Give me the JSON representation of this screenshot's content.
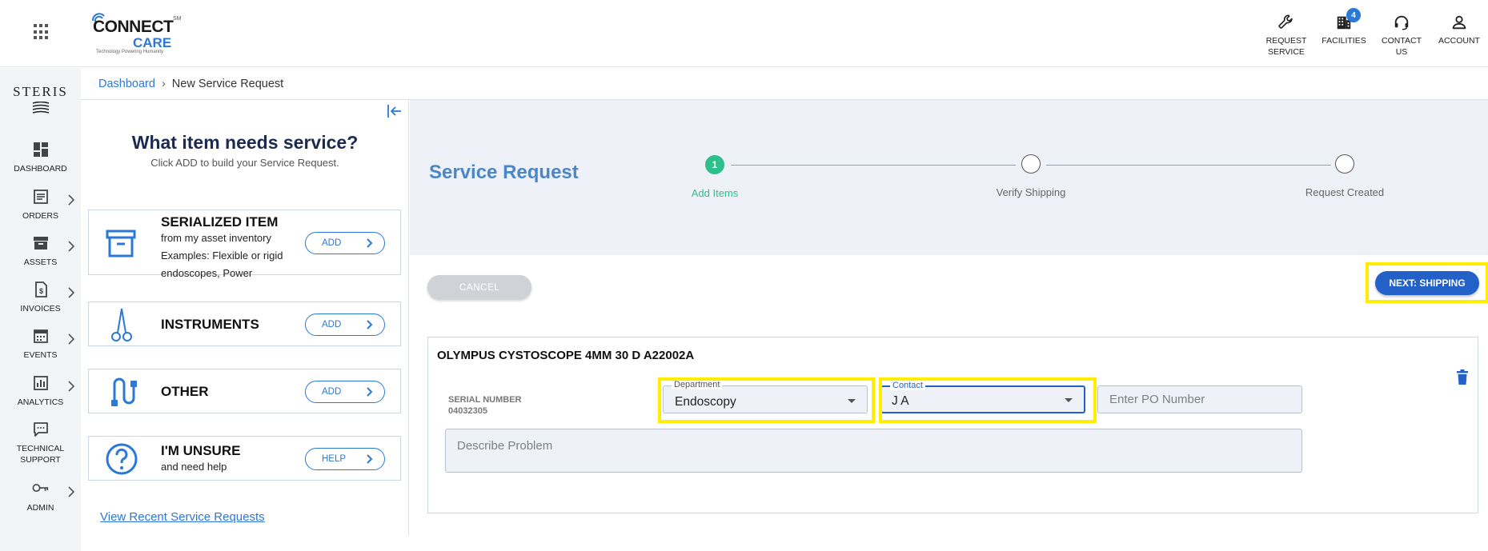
{
  "header": {
    "logo": {
      "brand_text": "CONNECT",
      "brand_sub": "CARE",
      "mark": "SM",
      "tagline": "Technology Powering Humanity"
    },
    "nav": [
      {
        "label": "REQUEST SERVICE",
        "icon": "wrench-icon"
      },
      {
        "label": "FACILITIES",
        "icon": "building-icon",
        "badge": "4"
      },
      {
        "label": "CONTACT US",
        "icon": "headset-icon"
      },
      {
        "label": "ACCOUNT",
        "icon": "user-icon"
      }
    ]
  },
  "rail": {
    "brand": "STERIS",
    "items": [
      {
        "label": "DASHBOARD",
        "icon": "dashboard-icon",
        "has_arrow": false
      },
      {
        "label": "ORDERS",
        "icon": "orders-icon",
        "has_arrow": true
      },
      {
        "label": "ASSETS",
        "icon": "archive-icon",
        "has_arrow": true
      },
      {
        "label": "INVOICES",
        "icon": "invoice-icon",
        "has_arrow": true
      },
      {
        "label": "EVENTS",
        "icon": "calendar-icon",
        "has_arrow": true
      },
      {
        "label": "ANALYTICS",
        "icon": "analytics-icon",
        "has_arrow": true
      },
      {
        "label": "TECHNICAL SUPPORT",
        "icon": "chat-icon",
        "has_arrow": false
      },
      {
        "label": "ADMIN",
        "icon": "key-icon",
        "has_arrow": true
      }
    ]
  },
  "breadcrumb": {
    "root": "Dashboard",
    "current": "New Service Request"
  },
  "panel": {
    "title": "What item needs service?",
    "subtitle": "Click ADD to build your Service Request.",
    "cards": [
      {
        "name": "SERIALIZED ITEM",
        "desc_lines": [
          "from my asset inventory",
          "Examples: Flexible or rigid",
          "endoscopes, Power"
        ],
        "button": "ADD",
        "icon": "archive-box-icon"
      },
      {
        "name": "INSTRUMENTS",
        "desc_lines": [],
        "button": "ADD",
        "icon": "scissors-icon"
      },
      {
        "name": "OTHER",
        "desc_lines": [],
        "button": "ADD",
        "icon": "cable-icon"
      },
      {
        "name": "I'M UNSURE",
        "desc_lines": [
          "and need help"
        ],
        "button": "HELP",
        "icon": "question-icon"
      }
    ],
    "recent_link": "View Recent Service Requests"
  },
  "main": {
    "title": "Service Request",
    "steps": [
      {
        "number": "1",
        "label": "Add Items",
        "active": true
      },
      {
        "number": "",
        "label": "Verify Shipping",
        "active": false
      },
      {
        "number": "",
        "label": "Request Created",
        "active": false
      }
    ],
    "cancel_label": "CANCEL",
    "next_label": "NEXT: SHIPPING",
    "item": {
      "title": "OLYMPUS CYSTOSCOPE 4MM 30 D A22002A",
      "serial_label": "SERIAL NUMBER",
      "serial_value": "04032305",
      "department_label": "Department",
      "department_value": "Endoscopy",
      "contact_label": "Contact",
      "contact_value": "J A",
      "po_placeholder": "Enter PO Number",
      "problem_placeholder": "Describe Problem"
    }
  },
  "colors": {
    "accent": "#2b78d6",
    "primary_button": "#2361c9",
    "step_active": "#2fbf8a",
    "highlight": "#ffee00"
  }
}
